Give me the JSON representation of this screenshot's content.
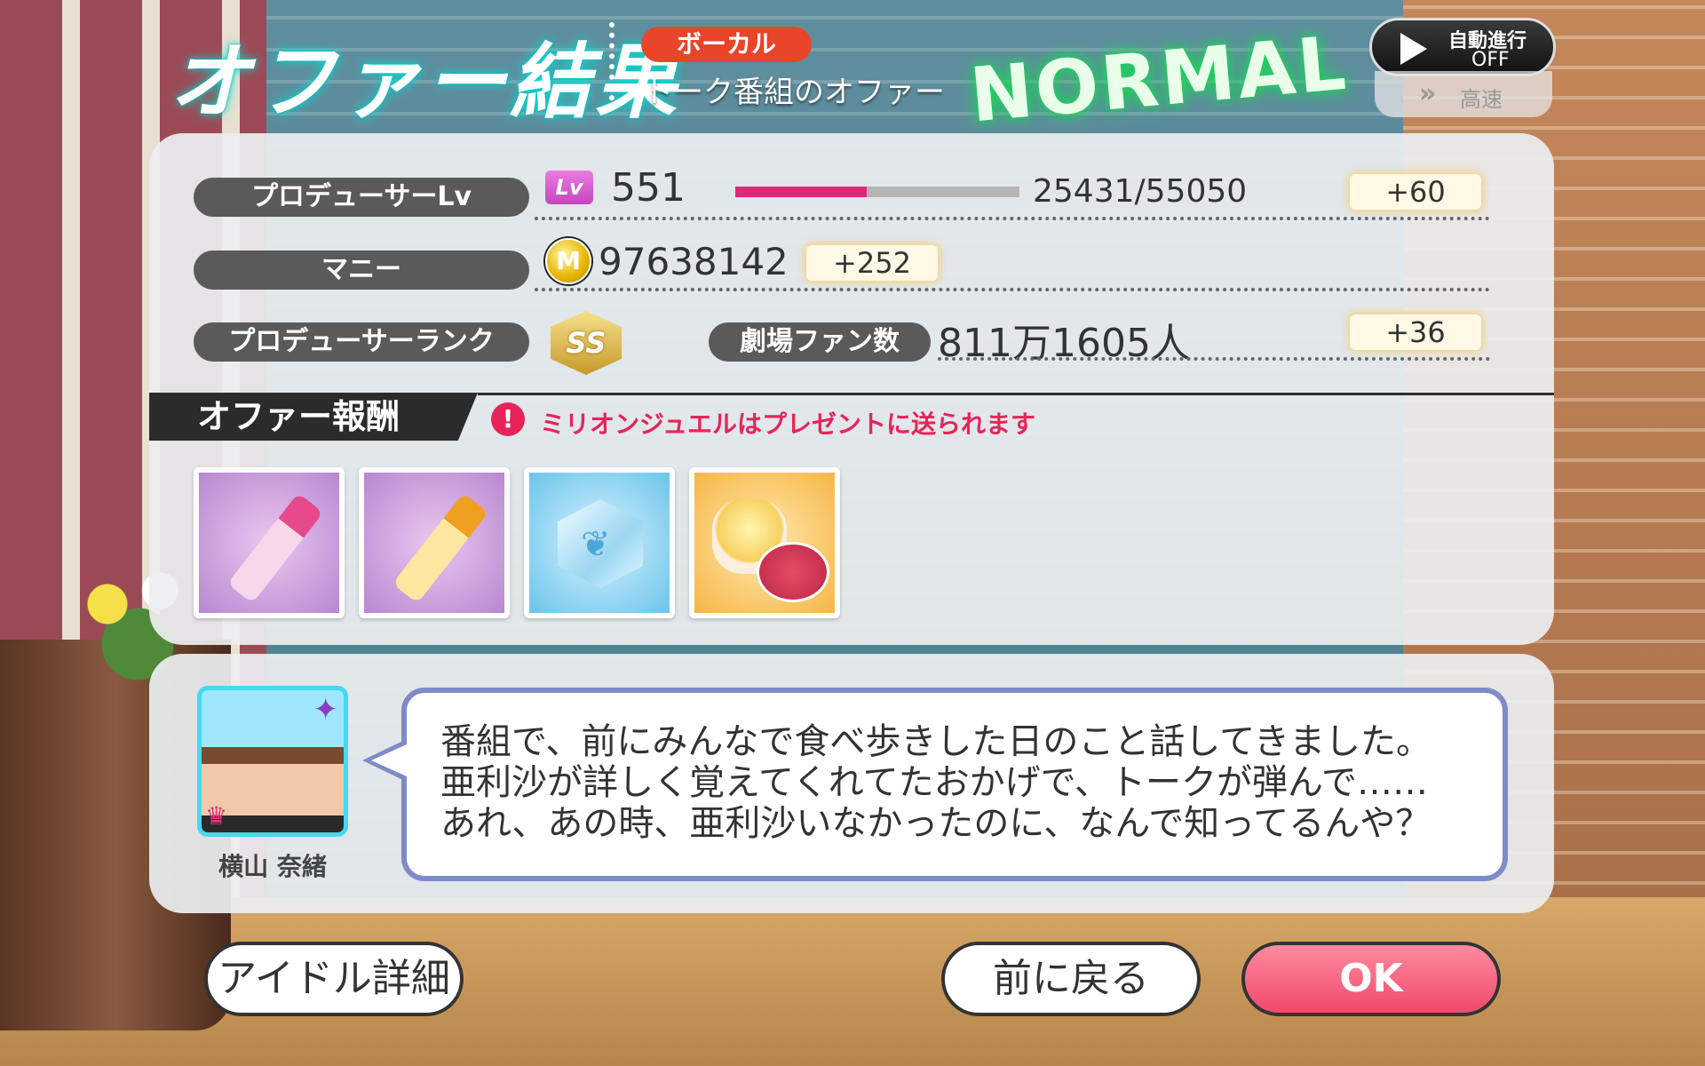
{
  "header": {
    "title": "オファー結果",
    "category_badge": "ボーカル",
    "offer_name": "トーク番組のオファー",
    "difficulty": "NORMAL",
    "auto_label": "自動進行",
    "auto_state": "OFF",
    "speed_label": "高速"
  },
  "stats": {
    "producer_lv": {
      "label": "プロデューサーLv",
      "icon_text": "Lv",
      "value": "551",
      "progress_text": "25431/55050",
      "progress": 0.462,
      "gain": "+60"
    },
    "money": {
      "label": "マニー",
      "icon_text": "M",
      "value": "97638142",
      "gain": "+252"
    },
    "rank": {
      "label": "プロデューサーランク",
      "badge": "SS",
      "fan_label": "劇場ファン数",
      "fan_value": "811万1605人",
      "gain": "+36"
    }
  },
  "rewards": {
    "header": "オファー報酬",
    "notice": "ミリオンジュエルはプレゼントに送られます",
    "items": [
      {
        "icon": "pink-lipstick-icon"
      },
      {
        "icon": "gold-lipstick-icon"
      },
      {
        "icon": "crystal-gem-icon"
      },
      {
        "icon": "cream-and-compact-icon"
      }
    ]
  },
  "dialogue": {
    "speaker": "横山 奈緒",
    "lines": [
      "番組で、前にみんなで食べ歩きした日のこと話してきました。",
      "亜利沙が詳しく覚えてくれてたおかげで、トークが弾んで……",
      "あれ、あの時、亜利沙いなかったのに、なんで知ってるんや？"
    ]
  },
  "buttons": {
    "idol_detail": "アイドル詳細",
    "back": "前に戻る",
    "ok": "OK"
  },
  "colors": {
    "accent_pink": "#e0287a",
    "ok_button": "#f04a6a",
    "badge_red": "#e8452a",
    "normal_glow": "#1dd35a"
  }
}
